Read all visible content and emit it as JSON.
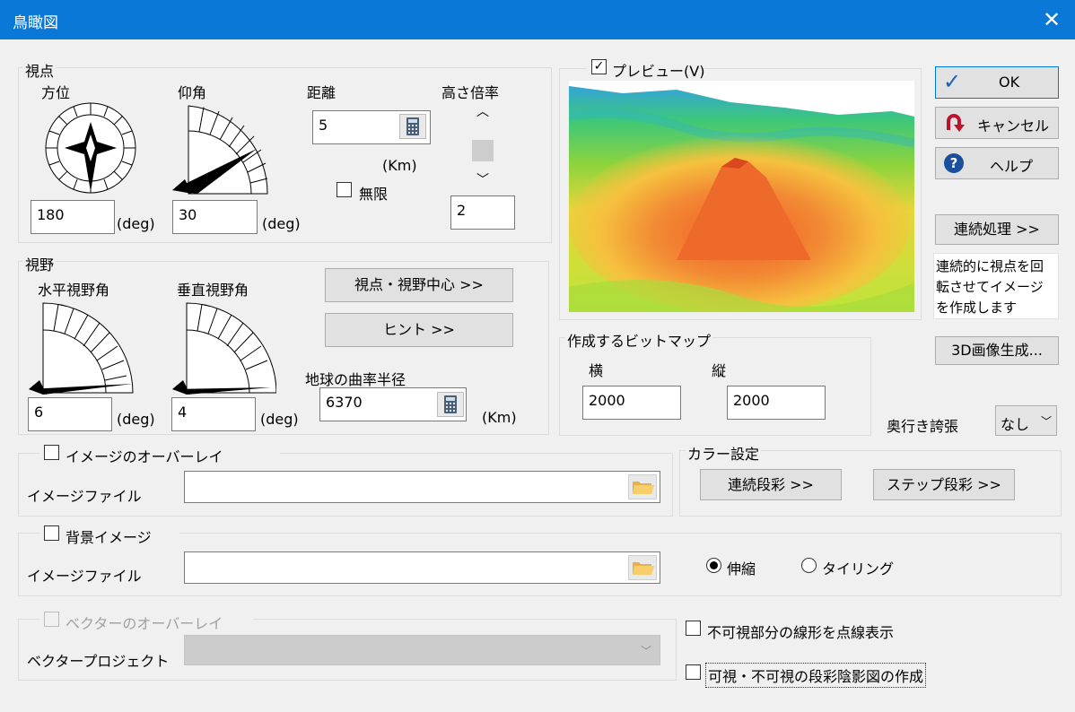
{
  "window": {
    "title": "鳥瞰図",
    "close_symbol": "✕"
  },
  "viewpoint": {
    "group_label": "視点",
    "azimuth_label": "方位",
    "azimuth_value": "180",
    "elevation_label": "仰角",
    "elevation_value": "30",
    "deg_unit": "(deg)",
    "distance_label": "距離",
    "distance_value": "5",
    "distance_unit": "(Km)",
    "infinite_label": "無限",
    "height_scale_label": "高さ倍率",
    "height_scale_value": "2"
  },
  "fov": {
    "group_label": "視野",
    "horizontal_label": "水平視野角",
    "horizontal_value": "6",
    "vertical_label": "垂直視野角",
    "vertical_value": "4",
    "deg_unit": "(deg)",
    "center_button": "視点・視野中心 >>",
    "hint_button": "ヒント >>",
    "earth_radius_label": "地球の曲率半径",
    "earth_radius_value": "6370",
    "earth_radius_unit": "(Km)"
  },
  "preview": {
    "label": "プレビュー(V)",
    "checked": true
  },
  "bitmap": {
    "group_label": "作成するビットマップ",
    "width_label": "横",
    "width_value": "2000",
    "height_label": "縦",
    "height_value": "2000"
  },
  "buttons": {
    "ok": "OK",
    "cancel": "キャンセル",
    "help": "ヘルプ",
    "continuous": "連続処理 >>",
    "continuous_desc": "連続的に視点を回転させてイメージを作成します",
    "generate_3d": "3D画像生成..."
  },
  "exaggeration": {
    "label": "奥行き誇張",
    "value": "なし"
  },
  "image_overlay": {
    "check_label": "イメージのオーバーレイ",
    "file_label": "イメージファイル",
    "file_value": ""
  },
  "color_settings": {
    "group_label": "カラー設定",
    "continuous_button": "連続段彩 >>",
    "step_button": "ステップ段彩 >>"
  },
  "background": {
    "check_label": "背景イメージ",
    "file_label": "イメージファイル",
    "file_value": "",
    "stretch_label": "伸縮",
    "tiling_label": "タイリング",
    "selected": "伸縮"
  },
  "vector": {
    "check_label": "ベクターのオーバーレイ",
    "project_label": "ベクタープロジェクト",
    "project_value": ""
  },
  "options": {
    "dotted_label": "不可視部分の線形を点線表示",
    "shading_label": "可視・不可視の段彩陰影図の作成"
  },
  "colors": {
    "titlebar": "#0a78d6",
    "ok_check": "#1b5fb8",
    "cancel_arrow": "#c0102a",
    "help_circle": "#1a4f9c"
  }
}
